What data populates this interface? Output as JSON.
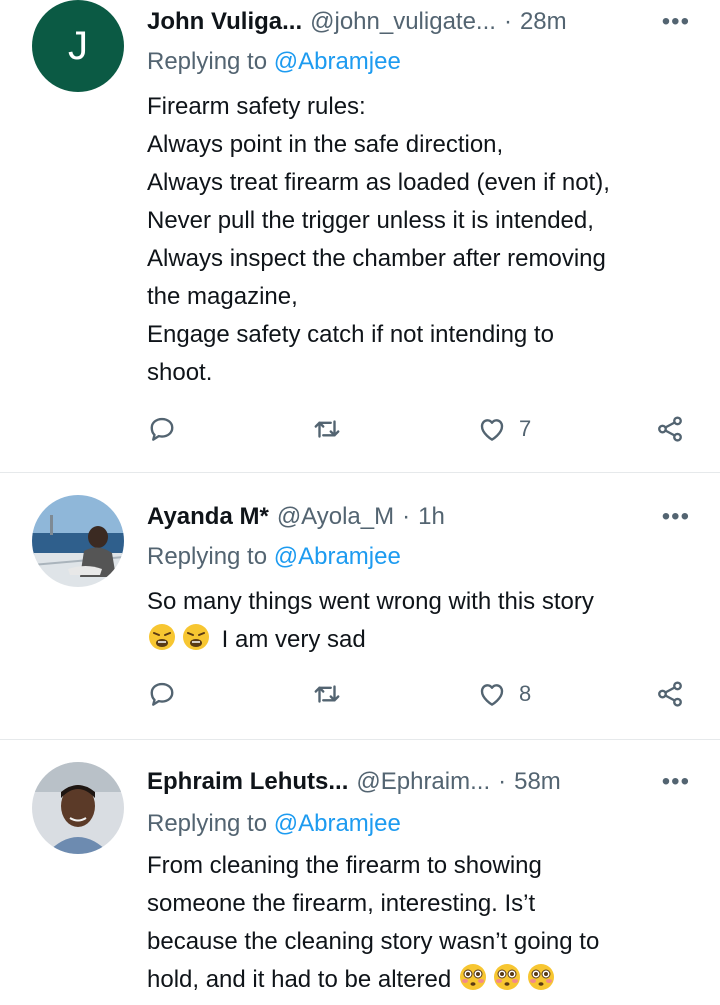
{
  "tweets": [
    {
      "avatar_letter": "J",
      "name": "John Vuliga...",
      "handle": "@john_vuligate...",
      "dot": "·",
      "time": "28m",
      "more": "•••",
      "replying_prefix": "Replying to",
      "replying_to": "@Abramjee",
      "lines": [
        "Firearm safety rules:",
        "Always point in the safe direction,",
        "Always treat firearm as loaded (even if not),",
        "Never pull the trigger unless it is intended,",
        "Always inspect the chamber after removing",
        "the magazine,",
        "Engage safety catch if not intending to",
        "shoot."
      ],
      "likes": "7"
    },
    {
      "name": "Ayanda M*",
      "handle": "@Ayola_M",
      "dot": "·",
      "time": "1h",
      "more": "•••",
      "replying_prefix": "Replying to",
      "replying_to": "@Abramjee",
      "lines": [
        "So many things went wrong with this story",
        "I am very sad"
      ],
      "emoji": "weary-face",
      "likes": "8"
    },
    {
      "name": "Ephraim Lehuts...",
      "handle": "@Ephraim...",
      "dot": "·",
      "time": "58m",
      "more": "•••",
      "replying_prefix": "Replying to",
      "replying_to": "@Abramjee",
      "lines": [
        "From cleaning the firearm to showing",
        "someone the firearm, interesting. Is’t",
        "because the cleaning story wasn’t going to",
        "hold, and it had to be altered"
      ],
      "emoji": "flushed-face"
    }
  ],
  "colors": {
    "text": "#0f1419",
    "muted": "#536471",
    "link": "#1d9bf0",
    "avatar_bg": "#0b5a44",
    "divider": "#e6e9eb"
  },
  "icons": [
    "reply-icon",
    "retweet-icon",
    "like-icon",
    "share-icon",
    "more-icon"
  ]
}
